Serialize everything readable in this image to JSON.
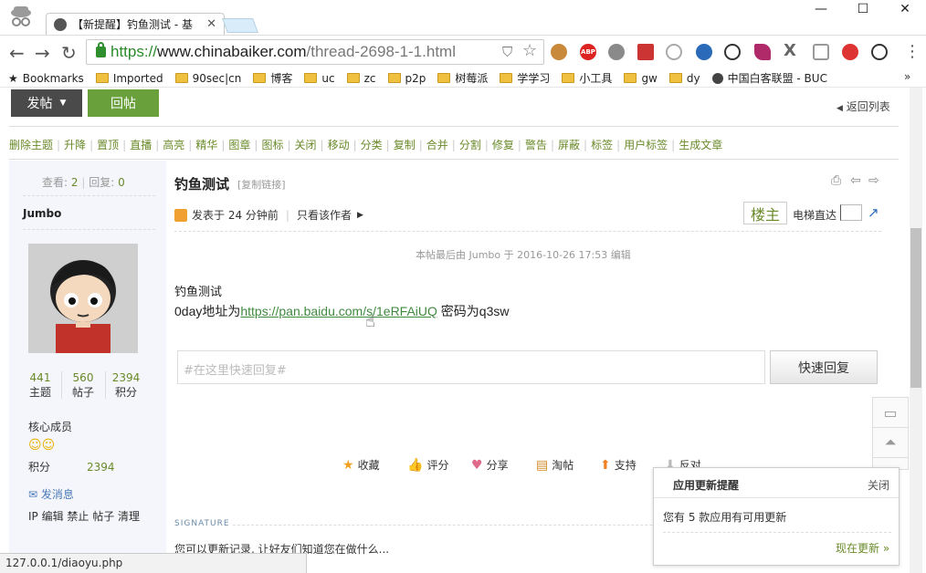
{
  "browser": {
    "tab_title": "【新提醒】钓鱼测试 - 基",
    "url_scheme": "https://",
    "url_host": "www.chinabaiker.com",
    "url_path": "/thread-2698-1-1.html",
    "window_controls": {
      "minimize": "—",
      "maximize": "☐",
      "close": "✕"
    },
    "extensions": [
      "cookie-icon",
      "adblock-icon",
      "globe-icon",
      "extension-red-icon",
      "cloud-icon",
      "earth-icon",
      "info-icon",
      "feather-icon",
      "x-icon",
      "shield-icon",
      "block-icon",
      "hash-icon"
    ],
    "adblock_label": "ABP"
  },
  "bookmarks": [
    {
      "label": "Bookmarks",
      "icon": "star"
    },
    {
      "label": "Imported",
      "icon": "folder"
    },
    {
      "label": "90sec|cn",
      "icon": "folder"
    },
    {
      "label": "博客",
      "icon": "folder"
    },
    {
      "label": "uc",
      "icon": "folder"
    },
    {
      "label": "zc",
      "icon": "folder"
    },
    {
      "label": "p2p",
      "icon": "folder"
    },
    {
      "label": "树莓派",
      "icon": "folder"
    },
    {
      "label": "学学习",
      "icon": "folder"
    },
    {
      "label": "小工具",
      "icon": "folder"
    },
    {
      "label": "gw",
      "icon": "folder"
    },
    {
      "label": "dy",
      "icon": "folder"
    },
    {
      "label": "中国白客联盟 - BUC",
      "icon": "site"
    }
  ],
  "bookmarks_more": "»",
  "page": {
    "post_button": "发帖",
    "reply_button": "回帖",
    "back_to_list": "返回列表",
    "admin_actions": [
      "删除主题",
      "升降",
      "置顶",
      "直播",
      "高亮",
      "精华",
      "图章",
      "图标",
      "关闭",
      "移动",
      "分类",
      "复制",
      "合并",
      "分割",
      "修复",
      "警告",
      "屏蔽",
      "标签",
      "用户标签",
      "生成文章"
    ],
    "views_label": "查看:",
    "views": "2",
    "replies_label": "回复:",
    "replies": "0",
    "author": "Jumbo",
    "author_stats": [
      {
        "value": "441",
        "label": "主题"
      },
      {
        "value": "560",
        "label": "帖子"
      },
      {
        "value": "2394",
        "label": "积分"
      }
    ],
    "rank": "核心成员",
    "points_label": "积分",
    "points": "2394",
    "send_message": "发消息",
    "admin_links": "IP 编辑 禁止 帖子 清理",
    "post_title": "钓鱼测试",
    "copy_link": "[复制链接]",
    "posted_time": "发表于 24 分钟前",
    "only_author": "只看该作者",
    "floor_owner": "楼主",
    "elevator": "电梯直达",
    "last_edited": "本帖最后由 Jumbo 于 2016-10-26 17:53 编辑",
    "body_line1": "钓鱼测试",
    "body_prefix": "0day地址为",
    "body_link": "https://pan.baidu.com/s/1eRFAiUQ",
    "body_suffix": " 密码为q3sw",
    "quick_reply_placeholder": "#在这里快速回复#",
    "quick_reply_button": "快速回复",
    "actions": [
      {
        "label": "收藏",
        "icon": "star-icon"
      },
      {
        "label": "评分",
        "icon": "thumb-icon"
      },
      {
        "label": "分享",
        "icon": "heart-icon"
      },
      {
        "label": "淘帖",
        "icon": "tray-icon"
      },
      {
        "label": "支持",
        "icon": "up-arrow-icon"
      },
      {
        "label": "反对",
        "icon": "down-arrow-icon"
      }
    ],
    "signature_label": "SIGNATURE",
    "signature_text": "您可以更新记录, 让好友们知道您在做什么..."
  },
  "popup": {
    "title": "应用更新提醒",
    "close": "关闭",
    "body": "您有 5 款应用有可用更新",
    "update_now": "现在更新 »"
  },
  "status_bar": "127.0.0.1/diaoyu.php",
  "colors": {
    "accent_green": "#6aa03c",
    "link_green": "#3f8a3f",
    "dark_button": "#4a4a4a"
  }
}
